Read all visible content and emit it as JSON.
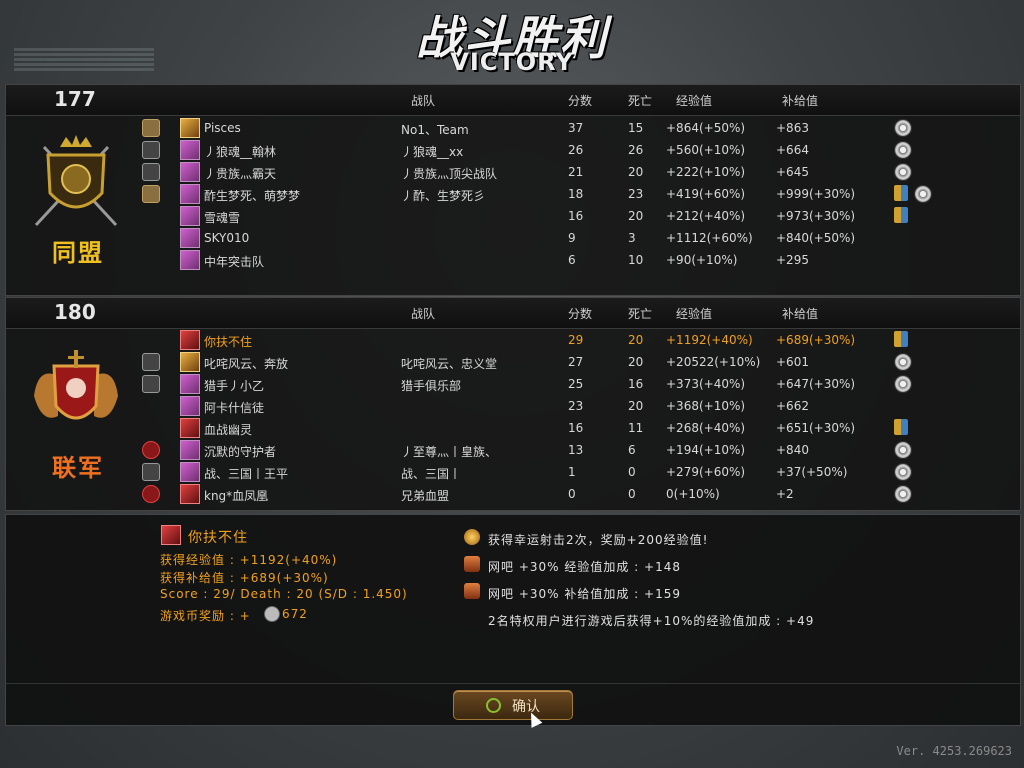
{
  "header": {
    "title_cn": "战斗胜利",
    "title_en": "VICTORY"
  },
  "columns": {
    "clan": "战队",
    "score": "分数",
    "death": "死亡",
    "exp": "经验值",
    "supply": "补给值"
  },
  "team1": {
    "score": "177",
    "name": "同盟",
    "color": "#f0c020",
    "players": [
      {
        "name": "Pisces",
        "clan": "No1、Team",
        "score": "37",
        "death": "15",
        "exp": "+864(+50%)",
        "supply": "+863",
        "rank": "gold",
        "avatar": "gold",
        "icons": [
          "medal"
        ]
      },
      {
        "name": "丿狼魂__翰林",
        "clan": "丿狼魂__xx",
        "score": "26",
        "death": "26",
        "exp": "+560(+10%)",
        "supply": "+664",
        "rank": "gray",
        "avatar": "purple",
        "icons": [
          "medal"
        ]
      },
      {
        "name": "丿贵族灬霸天",
        "clan": "丿贵族灬顶尖战队",
        "score": "21",
        "death": "20",
        "exp": "+222(+10%)",
        "supply": "+645",
        "rank": "gray",
        "avatar": "purple",
        "icons": [
          "medal"
        ]
      },
      {
        "name": "酢生梦死、萌梦梦",
        "clan": "丿酢、生梦死彡",
        "score": "18",
        "death": "23",
        "exp": "+419(+60%)",
        "supply": "+999(+30%)",
        "rank": "gold",
        "avatar": "purple",
        "icons": [
          "trophy",
          "medal"
        ]
      },
      {
        "name": "雪魂雪",
        "clan": "",
        "score": "16",
        "death": "20",
        "exp": "+212(+40%)",
        "supply": "+973(+30%)",
        "rank": "",
        "avatar": "purple",
        "icons": [
          "trophy"
        ]
      },
      {
        "name": "SKY010",
        "clan": "",
        "score": "9",
        "death": "3",
        "exp": "+1112(+60%)",
        "supply": "+840(+50%)",
        "rank": "",
        "avatar": "purple",
        "icons": []
      },
      {
        "name": "中年突击队",
        "clan": "",
        "score": "6",
        "death": "10",
        "exp": "+90(+10%)",
        "supply": "+295",
        "rank": "",
        "avatar": "purple",
        "icons": []
      }
    ]
  },
  "team2": {
    "score": "180",
    "name": "联军",
    "color": "#f07020",
    "players": [
      {
        "name": "你扶不住",
        "clan": "",
        "score": "29",
        "death": "20",
        "exp": "+1192(+40%)",
        "supply": "+689(+30%)",
        "rank": "",
        "avatar": "red",
        "icons": [
          "trophy"
        ],
        "highlight": true
      },
      {
        "name": "叱咤风云、奔放",
        "clan": "叱咤风云、忠义堂",
        "score": "27",
        "death": "20",
        "exp": "+20522(+10%)",
        "supply": "+601",
        "rank": "gray",
        "avatar": "gold",
        "icons": [
          "medal"
        ]
      },
      {
        "name": "猎手丿小乙",
        "clan": "猎手俱乐部",
        "score": "25",
        "death": "16",
        "exp": "+373(+40%)",
        "supply": "+647(+30%)",
        "rank": "gray",
        "avatar": "purple",
        "icons": [
          "medal"
        ]
      },
      {
        "name": "阿卡什信徒",
        "clan": "",
        "score": "23",
        "death": "20",
        "exp": "+368(+10%)",
        "supply": "+662",
        "rank": "",
        "avatar": "purple",
        "icons": []
      },
      {
        "name": "血战幽灵",
        "clan": "",
        "score": "16",
        "death": "11",
        "exp": "+268(+40%)",
        "supply": "+651(+30%)",
        "rank": "",
        "avatar": "red",
        "icons": [
          "trophy"
        ]
      },
      {
        "name": "沉默的守护者",
        "clan": "丿至尊灬丨皇族、",
        "score": "13",
        "death": "6",
        "exp": "+194(+10%)",
        "supply": "+840",
        "rank": "red",
        "avatar": "purple",
        "icons": [
          "medal"
        ]
      },
      {
        "name": "战、三国丨王平",
        "clan": "战、三国丨",
        "score": "1",
        "death": "0",
        "exp": "+279(+60%)",
        "supply": "+37(+50%)",
        "rank": "gray",
        "avatar": "purple",
        "icons": [
          "medal"
        ]
      },
      {
        "name": "kng*血凤凰",
        "clan": "兄弟血盟",
        "score": "0",
        "death": "0",
        "exp": "0(+10%)",
        "supply": "+2",
        "rank": "red",
        "avatar": "red",
        "icons": [
          "medal"
        ]
      }
    ]
  },
  "summary": {
    "player_name": "你扶不住",
    "exp_line": "获得经验值 : +1192(+40%)",
    "supply_line": "获得补给值 : +689(+30%)",
    "score_line": "Score : 29/ Death : 20  (S/D : 1.450)",
    "coin_label": "游戏币奖励 : +",
    "coin_value": "672",
    "bonuses": [
      {
        "text": "获得幸运射击2次，奖励+200经验值!",
        "icon": "gold"
      },
      {
        "text": "网吧 +30% 经验值加成 : +148",
        "icon": "bronze"
      },
      {
        "text": "网吧 +30% 补给值加成 : +159",
        "icon": "bronze"
      },
      {
        "text": "2名特权用户进行游戏后获得+10%的经验值加成 : +49",
        "icon": ""
      }
    ]
  },
  "confirm_label": "确认",
  "version": "Ver. 4253.269623"
}
